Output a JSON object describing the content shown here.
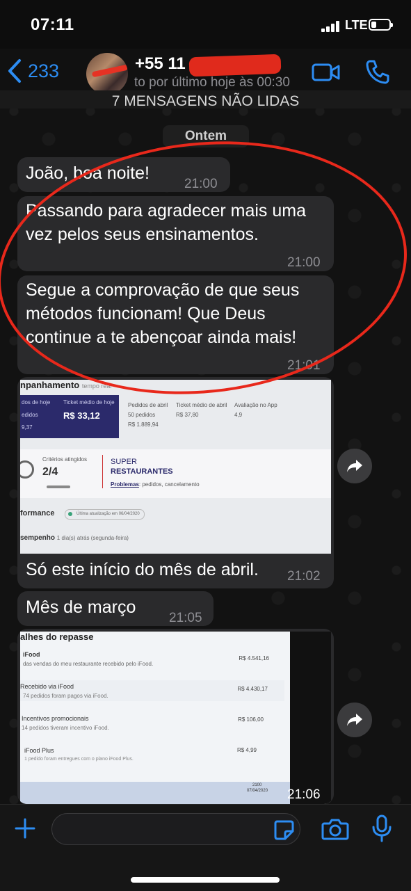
{
  "status_bar": {
    "time": "07:11",
    "network": "LTE"
  },
  "header": {
    "back_count": "233",
    "contact_name": "+55 11                  46",
    "last_seen": "to por último hoje às 00:30"
  },
  "unread_banner": "7 MENSAGENS NÃO LIDAS",
  "date_divider": "Ontem",
  "messages": [
    {
      "text": "João,  boa noite!",
      "time": "21:00"
    },
    {
      "text": "Passando para agradecer mais uma vez pelos seus ensinamentos.",
      "time": "21:00"
    },
    {
      "text": "Segue a comprovação de que seus métodos funcionam! Que Deus continue a te abençoar ainda mais!",
      "time": "21:01"
    },
    {
      "text": "Só este início do mês de abril.",
      "time": "21:02"
    },
    {
      "text": "Mês  de março",
      "time": "21:05"
    },
    {
      "text": "",
      "time": "21:06"
    }
  ],
  "image1": {
    "title": "npanhamento",
    "title_suffix": "tempo real",
    "card1_label": "dos de hoje",
    "card1_sub": "edidos",
    "card1_val": "9,37",
    "ticket_hoje_label": "Ticket médio de hoje",
    "ticket_hoje_val": "R$ 33,12",
    "pedidos_abril_label": "Pedidos de abril",
    "pedidos_abril_count": "50 pedidos",
    "pedidos_abril_val": "R$ 1.889,94",
    "ticket_abril_label": "Ticket médio de abril",
    "ticket_abril_val": "R$ 37,80",
    "avaliacao_label": "Avaliação no App",
    "avaliacao_val": "4,9",
    "criterios_label": "Critérios atingidos",
    "criterios_val": "2/4",
    "super_label": "SUPER",
    "restaurantes_label": "RESTAURANTES",
    "problemas_label": "Problemas",
    "problemas_text": ": pedidos, cancelamento",
    "performance_label": "formance",
    "ultima_label": "Última atualização em 06/04/2020",
    "desempenho_label": "sempenho",
    "desempenho_text": "1 dia(s) atrás (segunda-feira)"
  },
  "image2": {
    "title": "alhes do repasse",
    "rows": [
      {
        "label": "iFood",
        "desc": "das vendas do meu restaurante recebido pelo iFood.",
        "value": "R$ 4.541,16"
      },
      {
        "label": "Recebido via iFood",
        "desc": "74 pedidos foram pagos via iFood.",
        "value": "R$ 4.430,17"
      },
      {
        "label": "Incentivos promocionais",
        "desc": "14 pedidos tiveram incentivo iFood.",
        "value": "R$ 106,00"
      },
      {
        "label": "iFood Plus",
        "desc": "1 pedido foram entregues com o plano iFood Plus.",
        "value": "R$ 4,99"
      }
    ],
    "taskbar_time": "2100",
    "taskbar_date": "07/04/2020"
  }
}
